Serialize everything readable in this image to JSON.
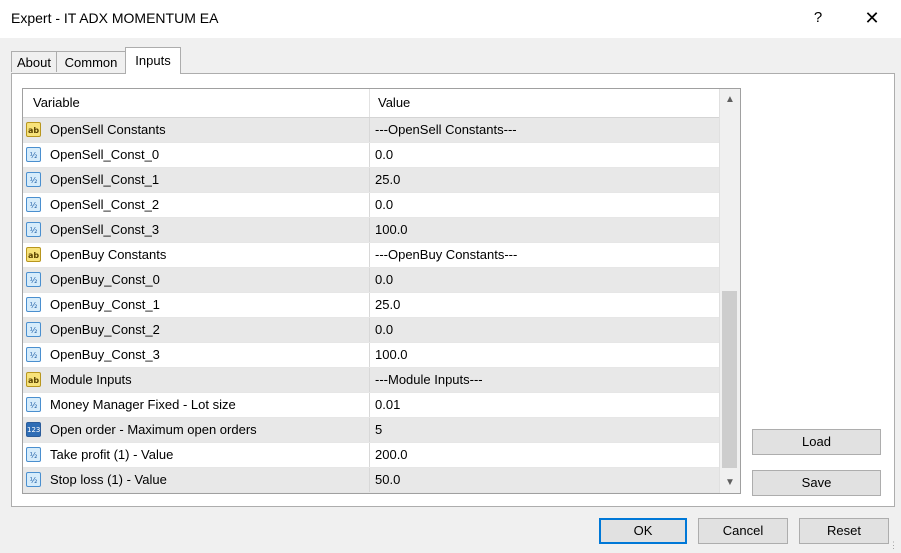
{
  "window": {
    "title": "Expert - IT ADX MOMENTUM EA",
    "help_label": "?",
    "close_label": "✕"
  },
  "tabs": [
    {
      "label": "About"
    },
    {
      "label": "Common"
    },
    {
      "label": "Inputs",
      "active": true
    }
  ],
  "grid": {
    "col_variable": "Variable",
    "col_value": "Value",
    "rows": [
      {
        "icon": "ab",
        "variable": "OpenSell Constants",
        "value": "---OpenSell Constants---"
      },
      {
        "icon": "v2",
        "variable": "OpenSell_Const_0",
        "value": "0.0"
      },
      {
        "icon": "v2",
        "variable": "OpenSell_Const_1",
        "value": "25.0"
      },
      {
        "icon": "v2",
        "variable": "OpenSell_Const_2",
        "value": "0.0"
      },
      {
        "icon": "v2",
        "variable": "OpenSell_Const_3",
        "value": "100.0"
      },
      {
        "icon": "ab",
        "variable": "OpenBuy Constants",
        "value": "---OpenBuy Constants---"
      },
      {
        "icon": "v2",
        "variable": "OpenBuy_Const_0",
        "value": "0.0"
      },
      {
        "icon": "v2",
        "variable": "OpenBuy_Const_1",
        "value": "25.0"
      },
      {
        "icon": "v2",
        "variable": "OpenBuy_Const_2",
        "value": "0.0"
      },
      {
        "icon": "v2",
        "variable": "OpenBuy_Const_3",
        "value": "100.0"
      },
      {
        "icon": "ab",
        "variable": "Module Inputs",
        "value": "---Module Inputs---"
      },
      {
        "icon": "v2",
        "variable": "Money Manager Fixed - Lot size",
        "value": "0.01"
      },
      {
        "icon": "123",
        "variable": "Open order - Maximum open orders",
        "value": "5"
      },
      {
        "icon": "v2",
        "variable": "Take profit (1) - Value",
        "value": "200.0"
      },
      {
        "icon": "v2",
        "variable": "Stop loss (1) - Value",
        "value": "50.0"
      }
    ]
  },
  "side_buttons": {
    "load": "Load",
    "save": "Save"
  },
  "footer_buttons": {
    "ok": "OK",
    "cancel": "Cancel",
    "reset": "Reset"
  },
  "icons": {
    "ab_glyph": "ab",
    "v2_glyph": "½",
    "n123_glyph": "123"
  }
}
